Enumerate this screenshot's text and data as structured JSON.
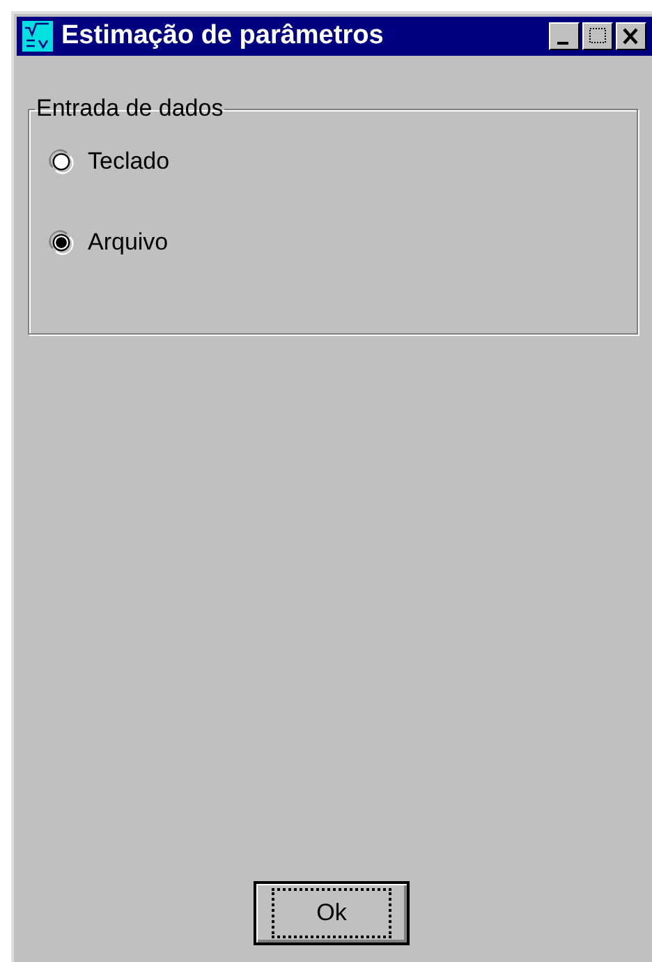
{
  "window": {
    "title": "Estimação de parâmetros"
  },
  "group": {
    "label": "Entrada de dados",
    "options": [
      {
        "label": "Teclado",
        "selected": false
      },
      {
        "label": "Arquivo",
        "selected": true
      }
    ]
  },
  "buttons": [
    {
      "label": "Ok",
      "focused": true
    }
  ]
}
